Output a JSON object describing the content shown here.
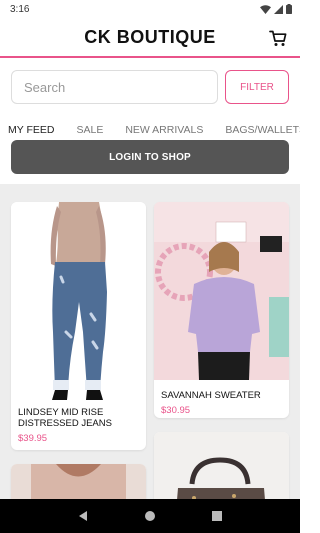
{
  "status": {
    "time": "3:16"
  },
  "header": {
    "title": "CK BOUTIQUE",
    "cart_icon": "cart-icon"
  },
  "search": {
    "placeholder": "Search",
    "filter_label": "FILTER"
  },
  "tabs": [
    {
      "label": "MY FEED",
      "active": true
    },
    {
      "label": "SALE"
    },
    {
      "label": "NEW ARRIVALS"
    },
    {
      "label": "BAGS/WALLETS"
    }
  ],
  "login": {
    "label": "LOGIN TO SHOP"
  },
  "products": [
    {
      "title": "LINDSEY MID RISE DISTRESSED JEANS",
      "price": "$39.95"
    },
    {
      "title": "SAVANNAH SWEATER",
      "price": "$30.95"
    }
  ],
  "colors": {
    "accent": "#e9538a",
    "login_bg": "#555555",
    "feed_bg": "#ededed"
  }
}
